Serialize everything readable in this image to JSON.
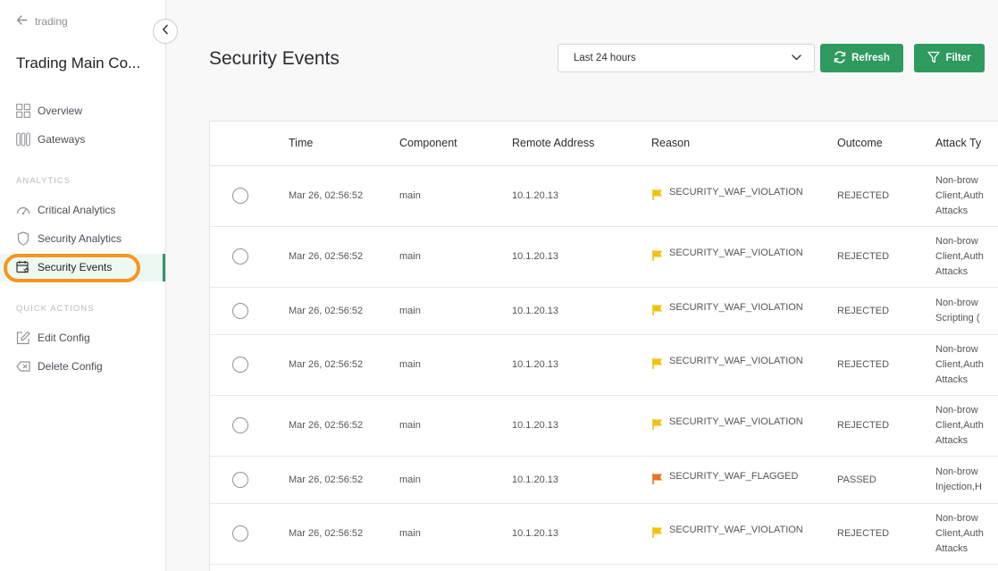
{
  "sidebar": {
    "back_label": "trading",
    "app_title": "Trading Main Co...",
    "items_top": [
      {
        "label": "Overview",
        "icon": "grid-icon"
      },
      {
        "label": "Gateways",
        "icon": "gateways-icon"
      }
    ],
    "analytics_label": "ANALYTICS",
    "analytics_items": [
      {
        "label": "Critical Analytics",
        "icon": "gauge-icon"
      },
      {
        "label": "Security Analytics",
        "icon": "shield-icon"
      },
      {
        "label": "Security Events",
        "icon": "calendar-star-icon"
      }
    ],
    "quick_actions_label": "QUICK ACTIONS",
    "quick_items": [
      {
        "label": "Edit Config",
        "icon": "edit-icon"
      },
      {
        "label": "Delete Config",
        "icon": "delete-icon"
      }
    ]
  },
  "header": {
    "title": "Security Events",
    "time_range": "Last 24 hours",
    "refresh_label": "Refresh",
    "filter_label": "Filter"
  },
  "colors": {
    "accent": "#2e9a5e",
    "highlight": "#f5961e",
    "flag_violation": "#f2c10e",
    "flag_flagged": "#e8742a"
  },
  "table": {
    "columns": [
      "Time",
      "Component",
      "Remote Address",
      "Reason",
      "Outcome",
      "Attack Ty"
    ],
    "rows": [
      {
        "time": "Mar 26, 02:56:52",
        "component": "main",
        "address": "10.1.20.13",
        "reason": "SECURITY_WAF_VIOLATION",
        "flag": "violation",
        "outcome": "REJECTED",
        "attack": [
          "Non-brow",
          "Client,Auth",
          "Attacks"
        ]
      },
      {
        "time": "Mar 26, 02:56:52",
        "component": "main",
        "address": "10.1.20.13",
        "reason": "SECURITY_WAF_VIOLATION",
        "flag": "violation",
        "outcome": "REJECTED",
        "attack": [
          "Non-brow",
          "Client,Auth",
          "Attacks"
        ]
      },
      {
        "time": "Mar 26, 02:56:52",
        "component": "main",
        "address": "10.1.20.13",
        "reason": "SECURITY_WAF_VIOLATION",
        "flag": "violation",
        "outcome": "REJECTED",
        "attack": [
          "Non-brow",
          "Scripting ("
        ]
      },
      {
        "time": "Mar 26, 02:56:52",
        "component": "main",
        "address": "10.1.20.13",
        "reason": "SECURITY_WAF_VIOLATION",
        "flag": "violation",
        "outcome": "REJECTED",
        "attack": [
          "Non-brow",
          "Client,Auth",
          "Attacks"
        ]
      },
      {
        "time": "Mar 26, 02:56:52",
        "component": "main",
        "address": "10.1.20.13",
        "reason": "SECURITY_WAF_VIOLATION",
        "flag": "violation",
        "outcome": "REJECTED",
        "attack": [
          "Non-brow",
          "Client,Auth",
          "Attacks"
        ]
      },
      {
        "time": "Mar 26, 02:56:52",
        "component": "main",
        "address": "10.1.20.13",
        "reason": "SECURITY_WAF_FLAGGED",
        "flag": "flagged",
        "outcome": "PASSED",
        "attack": [
          "Non-brow",
          "Injection,H"
        ]
      },
      {
        "time": "Mar 26, 02:56:52",
        "component": "main",
        "address": "10.1.20.13",
        "reason": "SECURITY_WAF_VIOLATION",
        "flag": "violation",
        "outcome": "REJECTED",
        "attack": [
          "Non-brow",
          "Client,Auth",
          "Attacks"
        ]
      }
    ]
  }
}
